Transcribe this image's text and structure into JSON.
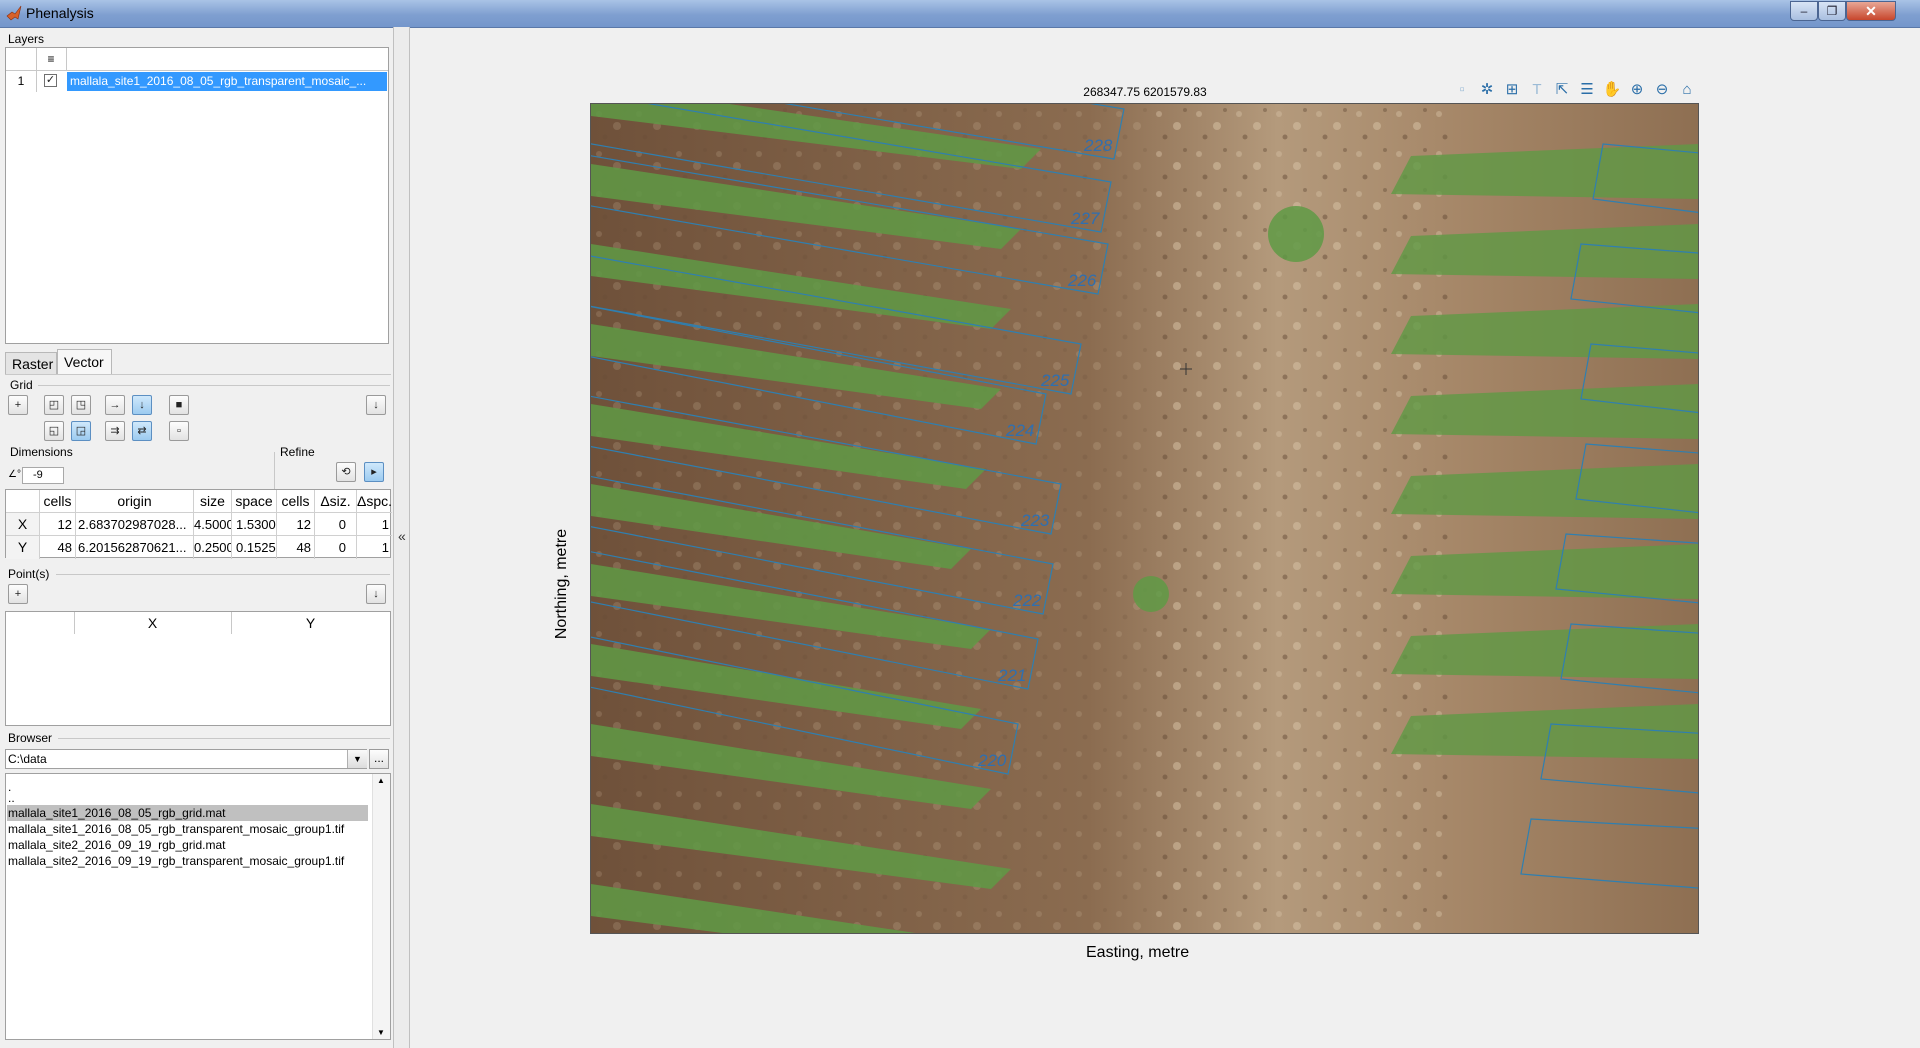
{
  "window": {
    "title": "Phenalysis",
    "controls": {
      "minimize": "–",
      "maximize": "❐",
      "close": "✕"
    }
  },
  "layers": {
    "title": "Layers",
    "header_icon": "≡",
    "rows": [
      {
        "index": "1",
        "checked": true,
        "name": "mallala_site1_2016_08_05_rgb_transparent_mosaic_..."
      }
    ]
  },
  "tabs": [
    {
      "label": "Raster",
      "active": false
    },
    {
      "label": "Vector",
      "active": true
    }
  ],
  "grid": {
    "title": "Grid",
    "dimensions_title": "Dimensions",
    "refine_title": "Refine",
    "rotation_value": "-9",
    "table": {
      "headers": [
        "",
        "cells",
        "origin",
        "size",
        "space",
        "cells",
        "Δsiz.",
        "Δspc."
      ],
      "rows": [
        [
          "X",
          "12",
          "2.683702987028...",
          "4.5000",
          "1.5300",
          "12",
          "0",
          "1"
        ],
        [
          "Y",
          "48",
          "6.201562870621...",
          "0.2500",
          "0.1525",
          "48",
          "0",
          "1"
        ]
      ]
    }
  },
  "points": {
    "title": "Point(s)",
    "headers": [
      "",
      "X",
      "Y"
    ]
  },
  "browser": {
    "title": "Browser",
    "path": "C:\\data",
    "more_label": "...",
    "items": [
      {
        "name": ".",
        "selected": false
      },
      {
        "name": "..",
        "selected": false
      },
      {
        "name": "mallala_site1_2016_08_05_rgb_grid.mat",
        "selected": true
      },
      {
        "name": "mallala_site1_2016_08_05_rgb_transparent_mosaic_group1.tif",
        "selected": false
      },
      {
        "name": "mallala_site2_2016_09_19_rgb_grid.mat",
        "selected": false
      },
      {
        "name": "mallala_site2_2016_09_19_rgb_transparent_mosaic_group1.tif",
        "selected": false
      }
    ]
  },
  "axes": {
    "coordinate_readout": "268347.75 6201579.83",
    "xlabel": "Easting, metre",
    "ylabel": "Northing, metre",
    "toolbar_icons": [
      "brush-icon",
      "data-cursor-icon",
      "grid-icon",
      "text-icon",
      "export-icon",
      "legend-icon",
      "pan-icon",
      "zoom-in-icon",
      "zoom-out-icon",
      "home-icon"
    ],
    "plot_labels": [
      "228",
      "227",
      "226",
      "225",
      "224",
      "223",
      "222",
      "221",
      "220"
    ]
  },
  "colors": {
    "accent": "#3399ff",
    "grid_line": "#2f7fb0",
    "plot_label": "#2f6fb0",
    "soil": "#8a6a4d",
    "crop": "#5f9a45"
  }
}
